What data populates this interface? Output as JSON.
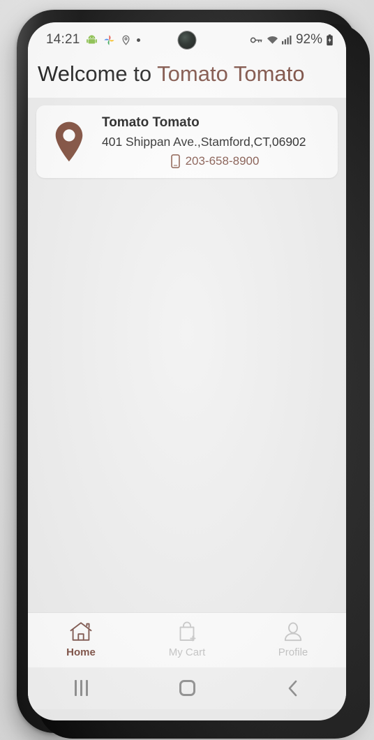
{
  "statusbar": {
    "time": "14:21",
    "left_icons": [
      "android-robot-icon",
      "google-photos-icon",
      "location-pin-icon",
      "dot-icon"
    ],
    "right_icons": [
      "vpn-key-icon",
      "wifi-icon",
      "cellular-signal-icon"
    ],
    "battery_percent": "92%",
    "battery_icon": "battery-charging-icon"
  },
  "header": {
    "welcome_text": "Welcome to ",
    "brand_name": "Tomato Tomato"
  },
  "store_card": {
    "pin_icon": "location-pin-icon",
    "name": "Tomato Tomato",
    "address": "401 Shippan Ave.,Stamford,CT,06902",
    "phone_icon": "smartphone-icon",
    "phone": "203-658-8900"
  },
  "bottom_nav": {
    "items": [
      {
        "label": "Home",
        "icon": "home-icon",
        "active": true
      },
      {
        "label": "My Cart",
        "icon": "shopping-bag-add-icon",
        "active": false
      },
      {
        "label": "Profile",
        "icon": "person-icon",
        "active": false
      }
    ]
  },
  "android_nav": {
    "recents": "recent-apps-icon",
    "home": "home-square-icon",
    "back": "back-chevron-icon"
  },
  "colors": {
    "brand_brown": "#7a4a3e",
    "pin_brown": "#7b4634",
    "inactive_gray": "#c4c4c4",
    "page_bg": "#efefef",
    "card_bg": "#ffffff"
  }
}
